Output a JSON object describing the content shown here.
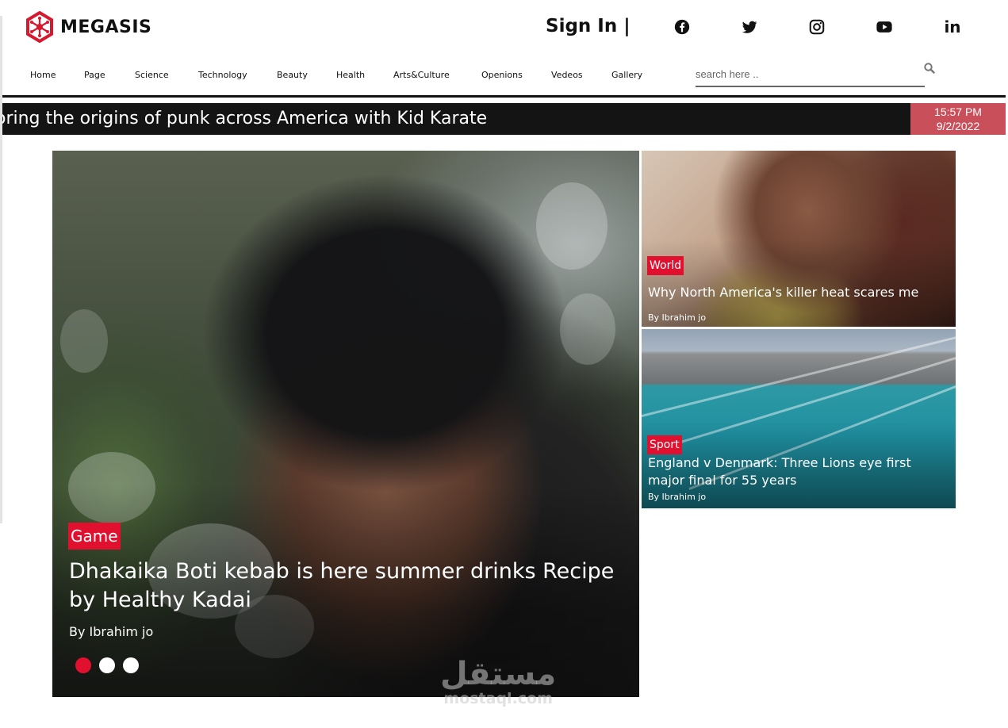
{
  "brand": {
    "name": "MEGASIS",
    "accent": "#d7192f"
  },
  "header": {
    "signin_label": "Sign In |",
    "social": [
      {
        "name": "facebook-icon"
      },
      {
        "name": "twitter-icon"
      },
      {
        "name": "instagram-icon"
      },
      {
        "name": "youtube-icon"
      },
      {
        "name": "linkedin-icon",
        "label": "in"
      }
    ]
  },
  "nav": {
    "items": [
      {
        "label": "Home"
      },
      {
        "label": "Page"
      },
      {
        "label": "Science"
      },
      {
        "label": "Technology"
      },
      {
        "label": "Beauty"
      },
      {
        "label": "Health"
      },
      {
        "label": "Arts&Culture"
      },
      {
        "label": "Openions"
      },
      {
        "label": "Vedeos"
      },
      {
        "label": "Gallery"
      }
    ],
    "search": {
      "placeholder": "search here ..",
      "value": ""
    }
  },
  "ticker": {
    "headline": "oring the origins of punk across America with Kid Karate",
    "time": "15:57 PM",
    "date": "9/2/2022",
    "clock_color": "#c94f5a"
  },
  "hero": {
    "tag": "Game",
    "title": "Dhakaika Boti kebab is here summer drinks Recipe by Healthy Kadai",
    "author": "By Ibrahim jo",
    "active_slide": 1,
    "slide_count": 3
  },
  "side_articles": [
    {
      "tag": "World",
      "title": "Why North America's killer heat scares me",
      "author": "By Ibrahim jo"
    },
    {
      "tag": "Sport",
      "title": "England v Denmark: Three Lions eye first major final for 55 years",
      "author": "By Ibrahim jo"
    }
  ],
  "watermark": {
    "arabic": "مستقل",
    "latin": "mostaql.com"
  },
  "colors": {
    "tag_red": "#e0102e",
    "ticker_bg": "#141414"
  }
}
